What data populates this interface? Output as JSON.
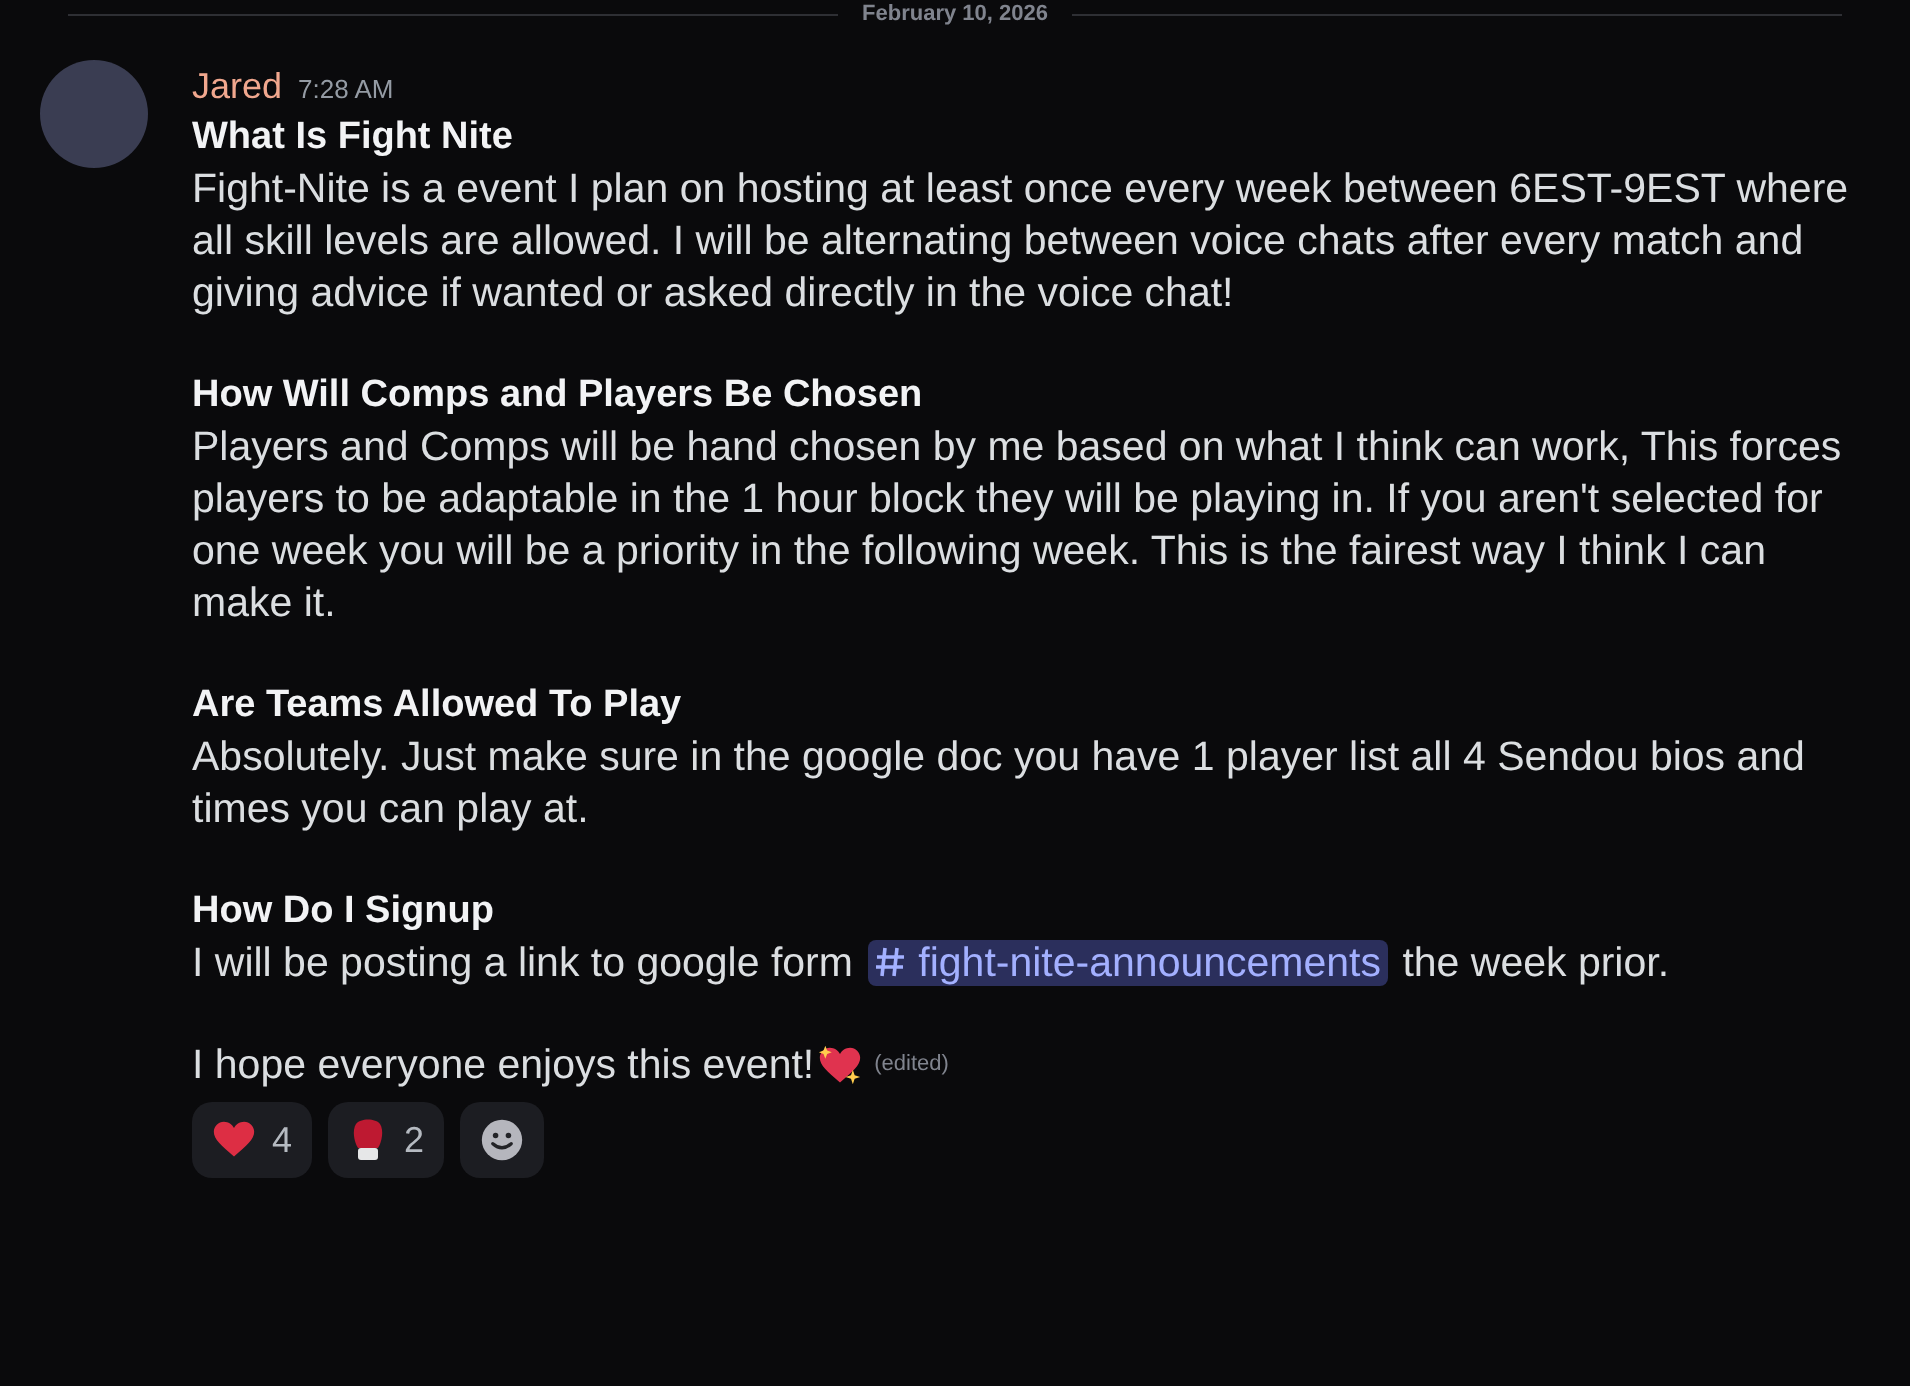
{
  "divider": {
    "date": "February 10, 2026"
  },
  "message": {
    "author": "Jared",
    "time": "7:28 AM",
    "sections": [
      {
        "heading": "What Is Fight Nite",
        "body": [
          {
            "kind": "text",
            "text": "Fight-Nite is a event I plan on hosting at least once every week between 6EST-9EST where all skill levels are allowed. I will be alternating between voice chats after every match and giving advice if wanted or asked directly in the voice chat!"
          }
        ]
      },
      {
        "heading": "How Will Comps and Players Be Chosen",
        "body": [
          {
            "kind": "text",
            "text": "Players and Comps will be hand chosen by me based on what I think can work, This forces players to be adaptable in the 1 hour block they will be playing in.  If you aren't selected for one week you will be a priority in the following week. This is the fairest way I think I can make it."
          }
        ]
      },
      {
        "heading": "Are Teams Allowed To Play",
        "body": [
          {
            "kind": "text",
            "text": "Absolutely. Just make sure in the google doc you have 1 player list all 4 Sendou bios and times you can play at."
          }
        ]
      },
      {
        "heading": "How Do I Signup",
        "body": [
          {
            "kind": "text",
            "text": "I will be posting a link to google form "
          },
          {
            "kind": "mention",
            "text": "fight-nite-announcements"
          },
          {
            "kind": "text",
            "text": " the week prior."
          }
        ]
      }
    ],
    "closing": "I hope everyone enjoys this event!",
    "edited": "(edited)"
  },
  "reactions": [
    {
      "kind": "heart",
      "count": "4"
    },
    {
      "kind": "glove",
      "count": "2"
    },
    {
      "kind": "add"
    }
  ]
}
